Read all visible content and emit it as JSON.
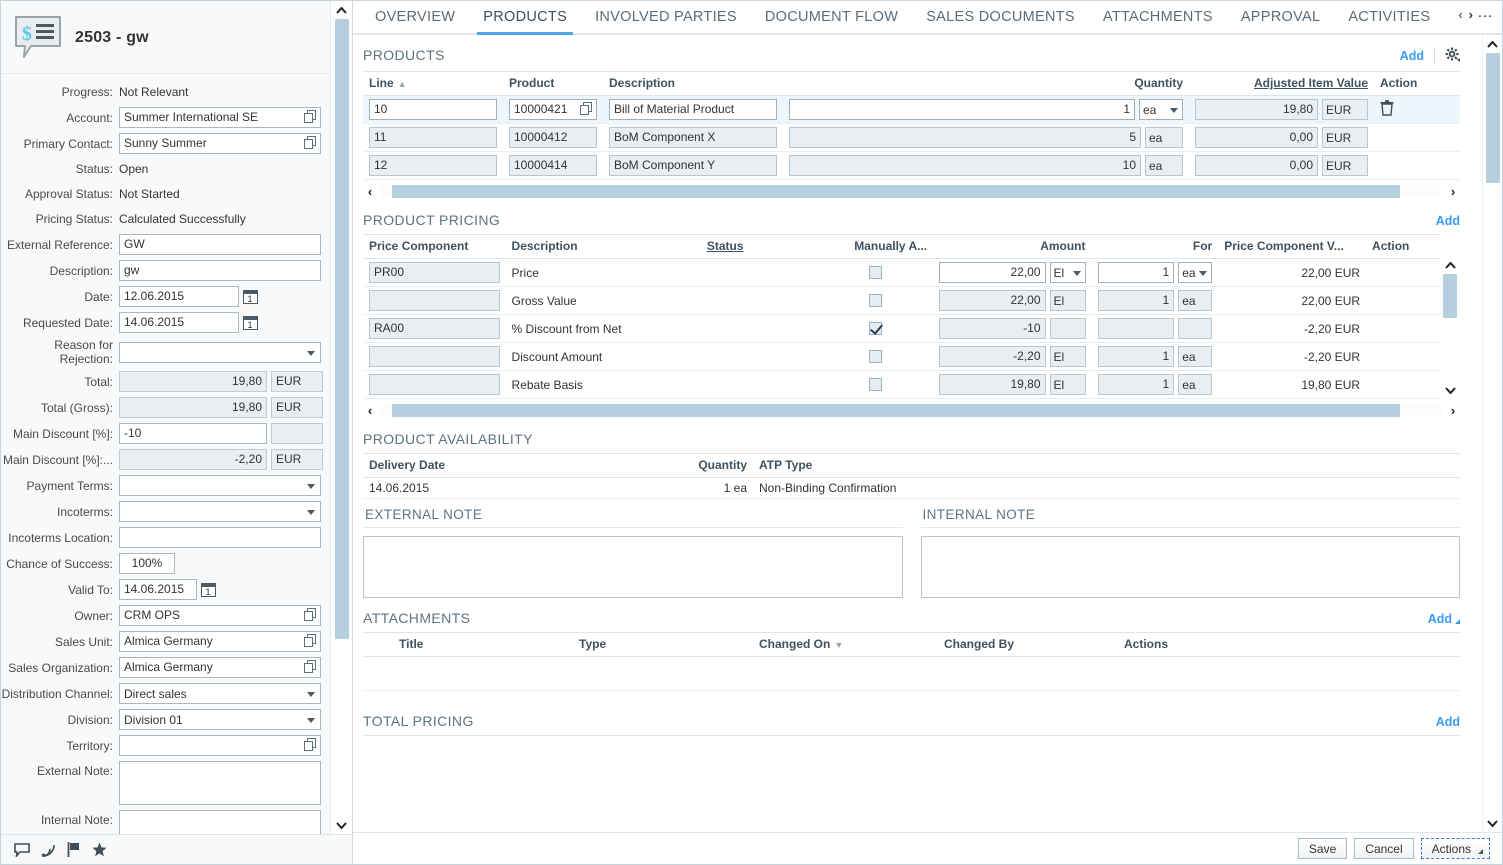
{
  "header": {
    "object_title": "2503 - gw",
    "object_icon": "quote-document-icon"
  },
  "tabs": [
    {
      "label": "OVERVIEW",
      "active": false
    },
    {
      "label": "PRODUCTS",
      "active": true
    },
    {
      "label": "INVOLVED PARTIES",
      "active": false
    },
    {
      "label": "DOCUMENT FLOW",
      "active": false
    },
    {
      "label": "SALES DOCUMENTS",
      "active": false
    },
    {
      "label": "ATTACHMENTS",
      "active": false
    },
    {
      "label": "APPROVAL",
      "active": false
    },
    {
      "label": "ACTIVITIES",
      "active": false
    }
  ],
  "tab_nav": {
    "prev": "‹",
    "next": "›",
    "more": "…"
  },
  "sidebar": {
    "fields": [
      {
        "label": "Progress:",
        "type": "text",
        "value": "Not Relevant"
      },
      {
        "label": "Account:",
        "type": "valuehelp",
        "value": "Summer International SE"
      },
      {
        "label": "Primary Contact:",
        "type": "valuehelp",
        "value": "Sunny Summer"
      },
      {
        "label": "Status:",
        "type": "text",
        "value": "Open"
      },
      {
        "label": "Approval Status:",
        "type": "text",
        "value": "Not Started"
      },
      {
        "label": "Pricing Status:",
        "type": "text",
        "value": "Calculated Successfully"
      },
      {
        "label": "External Reference:",
        "type": "input",
        "value": "GW"
      },
      {
        "label": "Description:",
        "type": "input",
        "value": "gw"
      },
      {
        "label": "Date:",
        "type": "date",
        "value": "12.06.2015"
      },
      {
        "label": "Requested Date:",
        "type": "date",
        "value": "14.06.2015"
      },
      {
        "label": "Reason for Rejection:",
        "type": "select",
        "value": ""
      },
      {
        "label": "Total:",
        "type": "currency",
        "value": "19,80",
        "currency": "EUR",
        "readonly": true
      },
      {
        "label": "Total (Gross):",
        "type": "currency",
        "value": "19,80",
        "currency": "EUR",
        "readonly": true
      },
      {
        "label": "Main Discount [%]:",
        "type": "currency",
        "value": "-10",
        "currency": "",
        "readonly": false
      },
      {
        "label": "Main Discount [%]:...",
        "type": "currency",
        "value": "-2,20",
        "currency": "EUR",
        "readonly": true
      },
      {
        "label": "Payment Terms:",
        "type": "select",
        "value": ""
      },
      {
        "label": "Incoterms:",
        "type": "select",
        "value": ""
      },
      {
        "label": "Incoterms Location:",
        "type": "input",
        "value": ""
      },
      {
        "label": "Chance of Success:",
        "type": "pct",
        "value": "100%"
      },
      {
        "label": "Valid To:",
        "type": "date",
        "value": "14.06.2015"
      },
      {
        "label": "Owner:",
        "type": "valuehelp",
        "value": "CRM OPS"
      },
      {
        "label": "Sales Unit:",
        "type": "valuehelp",
        "value": "Almica Germany"
      },
      {
        "label": "Sales Organization:",
        "type": "valuehelp",
        "value": "Almica Germany"
      },
      {
        "label": "Distribution Channel:",
        "type": "select",
        "value": "Direct sales"
      },
      {
        "label": "Division:",
        "type": "select",
        "value": "Division 01"
      },
      {
        "label": "Territory:",
        "type": "valuehelp",
        "value": ""
      },
      {
        "label": "External Note:",
        "type": "textarea",
        "value": ""
      },
      {
        "label": "Internal Note:",
        "type": "textarea",
        "value": ""
      }
    ],
    "footer_icons": [
      "comment-icon",
      "feed-icon",
      "flag-icon",
      "star-icon"
    ]
  },
  "products": {
    "title": "PRODUCTS",
    "add_label": "Add",
    "settings_icon": "gear-icon",
    "columns": [
      "Line",
      "Product",
      "Description",
      "Quantity",
      "Adjusted Item Value",
      "Action"
    ],
    "rows": [
      {
        "line": "10",
        "product": "10000421",
        "description": "Bill of Material Product",
        "quantity": "1",
        "unit": "ea",
        "adjusted_item_value": "19,80",
        "currency": "EUR",
        "action_icon": "delete-icon",
        "selected": true
      },
      {
        "line": "11",
        "product": "10000412",
        "description": "BoM Component X",
        "quantity": "5",
        "unit": "ea",
        "adjusted_item_value": "0,00",
        "currency": "EUR",
        "action_icon": "",
        "selected": false
      },
      {
        "line": "12",
        "product": "10000414",
        "description": "BoM Component Y",
        "quantity": "10",
        "unit": "ea",
        "adjusted_item_value": "0,00",
        "currency": "EUR",
        "action_icon": "",
        "selected": false
      }
    ]
  },
  "product_pricing": {
    "title": "PRODUCT PRICING",
    "add_label": "Add",
    "columns": [
      "Price Component",
      "Description",
      "Status",
      "Manually A...",
      "Amount",
      "For",
      "Price Component V...",
      "Action"
    ],
    "rows": [
      {
        "price_component": "PR00",
        "description": "Price",
        "status": "",
        "manually_applied": false,
        "amount": "22,00",
        "amount_unit": "El",
        "for_value": "1",
        "for_unit": "ea",
        "price_component_value": "22,00 EUR",
        "active": true
      },
      {
        "price_component": "",
        "description": "Gross Value",
        "status": "",
        "manually_applied": false,
        "amount": "22,00",
        "amount_unit": "El",
        "for_value": "1",
        "for_unit": "ea",
        "price_component_value": "22,00 EUR",
        "active": false
      },
      {
        "price_component": "RA00",
        "description": "% Discount from Net",
        "status": "",
        "manually_applied": true,
        "amount": "-10",
        "amount_unit": "",
        "for_value": "",
        "for_unit": "",
        "price_component_value": "-2,20 EUR",
        "active": false
      },
      {
        "price_component": "",
        "description": "Discount Amount",
        "status": "",
        "manually_applied": false,
        "amount": "-2,20",
        "amount_unit": "El",
        "for_value": "1",
        "for_unit": "ea",
        "price_component_value": "-2,20 EUR",
        "active": false
      },
      {
        "price_component": "",
        "description": "Rebate Basis",
        "status": "",
        "manually_applied": false,
        "amount": "19,80",
        "amount_unit": "El",
        "for_value": "1",
        "for_unit": "ea",
        "price_component_value": "19,80 EUR",
        "active": false
      }
    ]
  },
  "product_availability": {
    "title": "PRODUCT AVAILABILITY",
    "columns": [
      "Delivery Date",
      "Quantity",
      "ATP Type"
    ],
    "rows": [
      {
        "delivery_date": "14.06.2015",
        "quantity": "1 ea",
        "atp_type": "Non-Binding Confirmation"
      }
    ]
  },
  "external_note": {
    "title": "EXTERNAL NOTE",
    "value": ""
  },
  "internal_note": {
    "title": "INTERNAL NOTE",
    "value": ""
  },
  "attachments": {
    "title": "ATTACHMENTS",
    "add_label": "Add",
    "columns": [
      "Title",
      "Type",
      "Changed On",
      "Changed By",
      "Actions"
    ],
    "rows": []
  },
  "total_pricing": {
    "title": "TOTAL PRICING",
    "add_label": "Add"
  },
  "footer": {
    "save_label": "Save",
    "cancel_label": "Cancel",
    "actions_label": "Actions"
  },
  "colors": {
    "accent": "#3a9bf0",
    "tab_underline": "#4ca6e8",
    "readonly_field": "#e8eef2",
    "scrollbar": "#b6cfde",
    "section_title": "#5e7382"
  }
}
